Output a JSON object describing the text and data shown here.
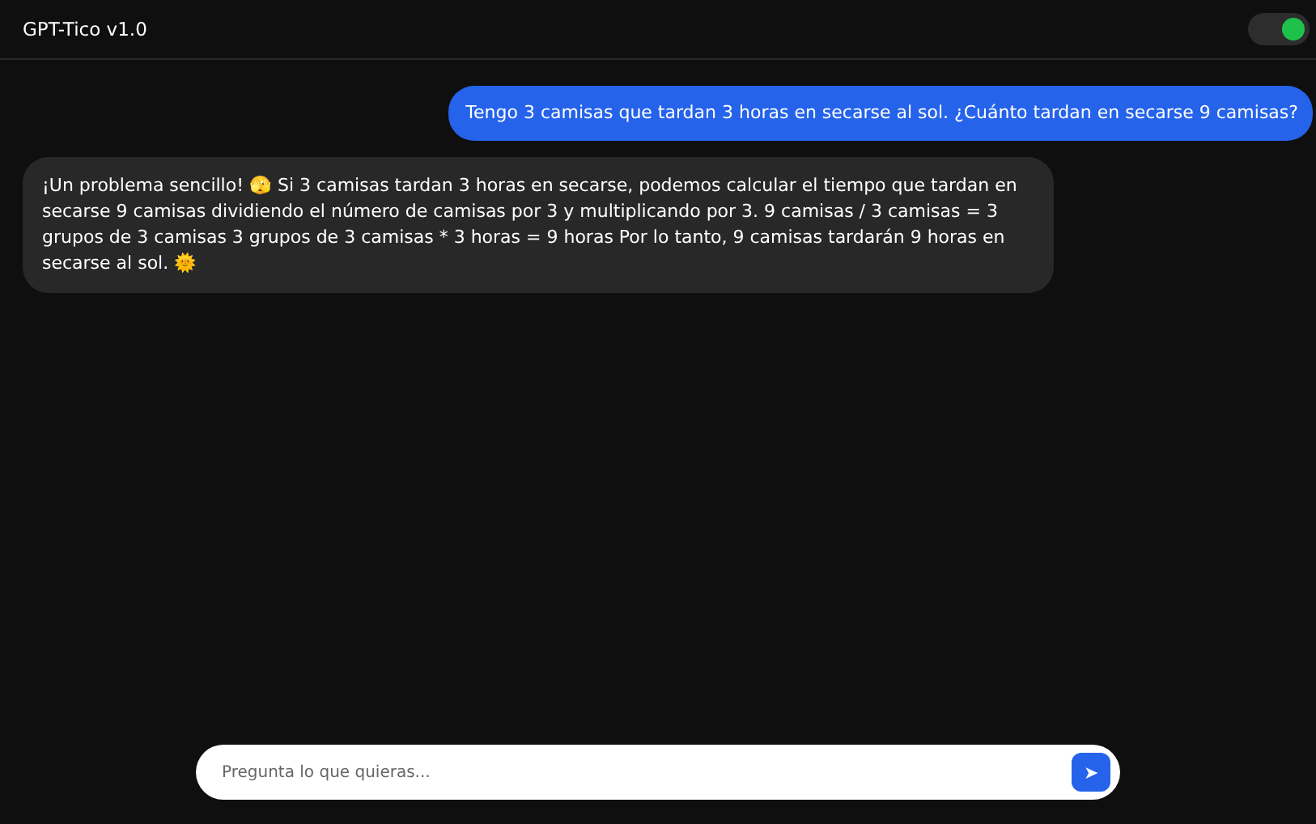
{
  "header": {
    "title": "GPT-Tico v1.0",
    "toggle": {
      "on": true
    }
  },
  "messages": [
    {
      "kind": "user",
      "text": "Tengo 3 camisas que tardan 3 horas en secarse al sol. ¿Cuánto tardan en secarse 9 camisas?"
    },
    {
      "kind": "bot",
      "text": "¡Un problema sencillo! 🫣 Si 3 camisas tardan 3 horas en secarse, podemos calcular el tiempo que tardan en secarse 9 camisas dividiendo el número de camisas por 3 y multiplicando por 3. 9 camisas / 3 camisas = 3 grupos de 3 camisas 3 grupos de 3 camisas * 3 horas = 9 horas Por lo tanto, 9 camisas tardarán 9 horas en secarse al sol. 🌞"
    }
  ],
  "composer": {
    "placeholder": "Pregunta lo que quieras...",
    "send": "➤"
  }
}
